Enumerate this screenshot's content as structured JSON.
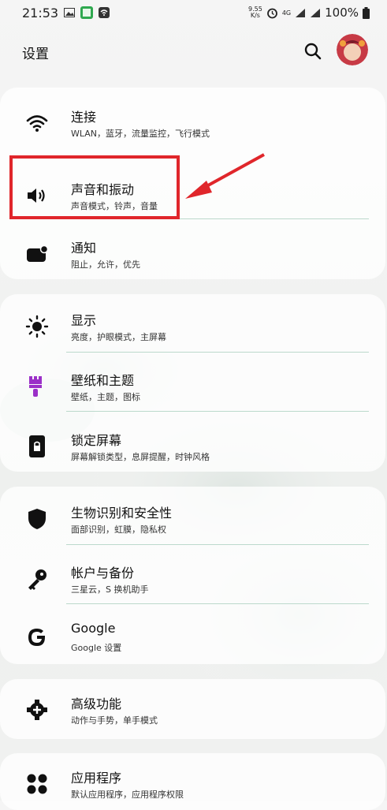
{
  "status": {
    "time": "21:53",
    "speed_top": "9.55",
    "speed_bottom": "K/s",
    "net": "4G",
    "battery": "100%"
  },
  "header": {
    "title": "设置"
  },
  "sections": [
    {
      "items": [
        {
          "icon": "wifi-icon",
          "title": "连接",
          "subtitle": "WLAN，蓝牙，流量监控，飞行模式"
        },
        {
          "icon": "volume-icon",
          "title": "声音和振动",
          "subtitle": "声音模式，铃声，音量"
        },
        {
          "icon": "notification-icon",
          "title": "通知",
          "subtitle": "阻止，允许，优先"
        }
      ]
    },
    {
      "items": [
        {
          "icon": "brightness-icon",
          "title": "显示",
          "subtitle": "亮度，护眼模式，主屏幕"
        },
        {
          "icon": "paintbrush-icon",
          "title": "壁纸和主题",
          "subtitle": "壁纸，主题，图标"
        },
        {
          "icon": "lock-screen-icon",
          "title": "锁定屏幕",
          "subtitle": "屏幕解锁类型，息屏提醒，时钟风格"
        }
      ]
    },
    {
      "items": [
        {
          "icon": "shield-icon",
          "title": "生物识别和安全性",
          "subtitle": "面部识别，虹膜，隐私权"
        },
        {
          "icon": "key-icon",
          "title": "帐户与备份",
          "subtitle": "三星云，S 换机助手"
        },
        {
          "icon": "google-icon",
          "title": "Google",
          "subtitle": "Google 设置"
        }
      ]
    },
    {
      "items": [
        {
          "icon": "gear-plus-icon",
          "title": "高级功能",
          "subtitle": "动作与手势，单手模式"
        }
      ]
    },
    {
      "items": [
        {
          "icon": "apps-icon",
          "title": "应用程序",
          "subtitle": "默认应用程序，应用程序权限"
        }
      ]
    }
  ],
  "colors": {
    "highlight": "#e0262b",
    "divider": "#bcd9cc",
    "paintbrush": "#9b30c8"
  }
}
